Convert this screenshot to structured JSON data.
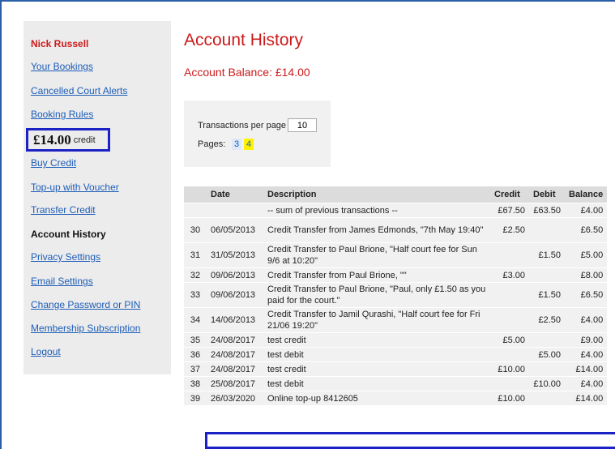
{
  "sidebar": {
    "user_name": "Nick Russell",
    "nav_items": [
      {
        "label": "Your Bookings"
      },
      {
        "label": "Cancelled Court Alerts"
      },
      {
        "label": "Booking Rules"
      },
      {
        "label": "Buy Credit"
      },
      {
        "label": "Top-up with Voucher"
      },
      {
        "label": "Transfer Credit"
      },
      {
        "label": "Account History",
        "current": true
      },
      {
        "label": "Privacy Settings"
      },
      {
        "label": "Email Settings"
      },
      {
        "label": "Change Password or PIN"
      },
      {
        "label": "Membership Subscription"
      },
      {
        "label": "Logout"
      }
    ],
    "credit": {
      "amount": "£14.00",
      "label": "credit"
    }
  },
  "main": {
    "title": "Account History",
    "balance": "Account Balance: £14.00",
    "paging": {
      "per_page_label": "Transactions per page",
      "per_page_value": "10",
      "pages_label": "Pages:",
      "pages": [
        "3",
        "4"
      ],
      "current_page": "4"
    },
    "table": {
      "headers": {
        "idx": "",
        "date": "Date",
        "description": "Description",
        "credit": "Credit",
        "debit": "Debit",
        "balance": "Balance"
      },
      "summary": {
        "description": "-- sum of previous transactions --",
        "credit": "£67.50",
        "debit": "£63.50",
        "balance": "£4.00"
      },
      "rows": [
        {
          "idx": "30",
          "date": "06/05/2013",
          "description": "Credit Transfer from James Edmonds, \"7th May 19:40\"",
          "credit": "£2.50",
          "debit": "",
          "balance": "£6.50"
        },
        {
          "idx": "31",
          "date": "31/05/2013",
          "description": "Credit Transfer to Paul Brione, \"Half court fee for Sun 9/6 at 10:20\"",
          "credit": "",
          "debit": "£1.50",
          "balance": "£5.00"
        },
        {
          "idx": "32",
          "date": "09/06/2013",
          "description": "Credit Transfer from Paul Brione, \"\"",
          "credit": "£3.00",
          "debit": "",
          "balance": "£8.00"
        },
        {
          "idx": "33",
          "date": "09/06/2013",
          "description": "Credit Transfer to Paul Brione, \"Paul, only £1.50 as you paid for the court.\"",
          "credit": "",
          "debit": "£1.50",
          "balance": "£6.50"
        },
        {
          "idx": "34",
          "date": "14/06/2013",
          "description": "Credit Transfer to Jamil Qurashi, \"Half court fee for Fri 21/06 19:20\"",
          "credit": "",
          "debit": "£2.50",
          "balance": "£4.00"
        },
        {
          "idx": "35",
          "date": "24/08/2017",
          "description": "test credit",
          "credit": "£5.00",
          "debit": "",
          "balance": "£9.00"
        },
        {
          "idx": "36",
          "date": "24/08/2017",
          "description": "test debit",
          "credit": "",
          "debit": "£5.00",
          "balance": "£4.00"
        },
        {
          "idx": "37",
          "date": "24/08/2017",
          "description": "test credit",
          "credit": "£10.00",
          "debit": "",
          "balance": "£14.00"
        },
        {
          "idx": "38",
          "date": "25/08/2017",
          "description": "test debit",
          "credit": "",
          "debit": "£10.00",
          "balance": "£4.00"
        },
        {
          "idx": "39",
          "date": "26/03/2020",
          "description": "Online top-up 8412605",
          "credit": "£10.00",
          "debit": "",
          "balance": "£14.00"
        }
      ]
    }
  },
  "colors": {
    "accent_red": "#cc1b1b",
    "link_blue": "#1d5db8",
    "highlight_border": "#1b22c4",
    "current_page": "#fff200"
  }
}
